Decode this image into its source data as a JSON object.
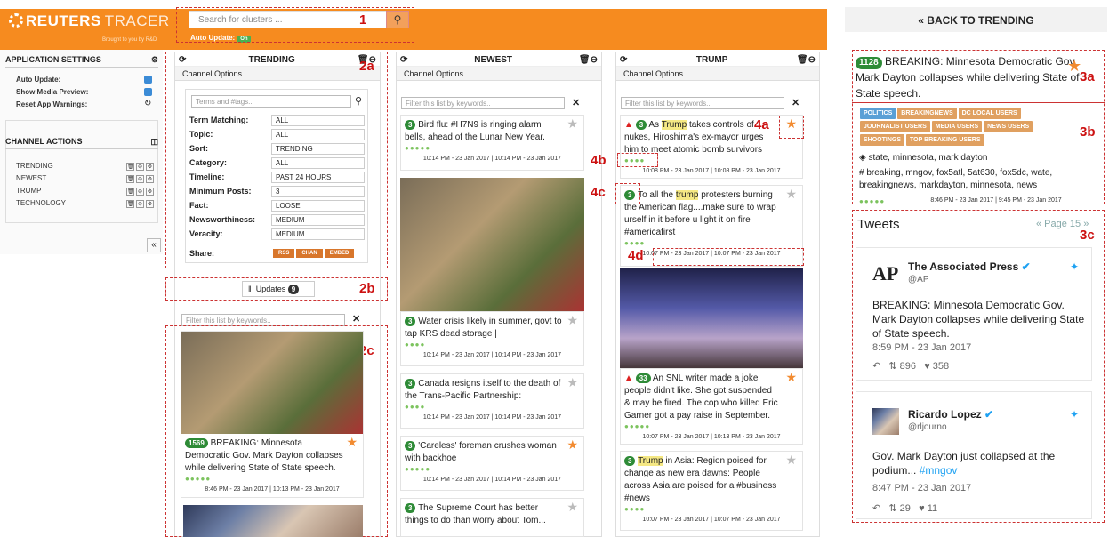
{
  "header": {
    "logo_text": "REUTERS",
    "logo_sub_text": "TRACER",
    "tagline": "Brought to you by R&D",
    "search_placeholder": "Search for clusters ...",
    "auto_update_label": "Auto Update:",
    "auto_update_state": "On"
  },
  "callouts": {
    "c1": "1",
    "c2a": "2a",
    "c2b": "2b",
    "c2c": "2c",
    "c3a": "3a",
    "c3b": "3b",
    "c3c": "3c",
    "c4a": "4a",
    "c4b": "4b",
    "c4c": "4c",
    "c4d": "4d"
  },
  "left": {
    "app_settings_title": "APPLICATION SETTINGS",
    "settings": [
      "Auto Update:",
      "Show Media Preview:",
      "Reset App Warnings:"
    ],
    "channel_actions_title": "CHANNEL ACTIONS",
    "channels": [
      "TRENDING",
      "NEWEST",
      "TRUMP",
      "TECHNOLOGY"
    ]
  },
  "trending": {
    "title": "TRENDING",
    "channel_options": "Channel Options",
    "terms_placeholder": "Terms and #tags..",
    "options": [
      {
        "label": "Term Matching:",
        "value": "ALL"
      },
      {
        "label": "Topic:",
        "value": "ALL"
      },
      {
        "label": "Sort:",
        "value": "TRENDING"
      },
      {
        "label": "Category:",
        "value": "ALL"
      },
      {
        "label": "Timeline:",
        "value": "PAST 24 HOURS"
      },
      {
        "label": "Minimum Posts:",
        "value": "3"
      },
      {
        "label": "Fact:",
        "value": "LOOSE"
      },
      {
        "label": "Newsworthiness:",
        "value": "MEDIUM"
      },
      {
        "label": "Veracity:",
        "value": "MEDIUM"
      }
    ],
    "share_label": "Share:",
    "share_buttons": [
      "RSS",
      "CHAN",
      "EMBED"
    ],
    "updates_label": "Updates",
    "updates_count": "9",
    "filter_placeholder": "Filter this list by keywords..",
    "card": {
      "count": "1569",
      "text": "BREAKING: Minnesota Democratic Gov. Mark Dayton collapses while delivering State of State speech.",
      "time": "8:46 PM - 23 Jan 2017 | 10:13 PM - 23 Jan 2017"
    }
  },
  "newest": {
    "title": "NEWEST",
    "channel_options": "Channel Options",
    "filter_placeholder": "Filter this list by keywords..",
    "cards": [
      {
        "count": "3",
        "text": "Bird flu: #H7N9 is ringing alarm bells, ahead of the Lunar New Year.",
        "time": "10:14 PM - 23 Jan 2017 | 10:14 PM - 23 Jan 2017"
      },
      {
        "count": "3",
        "text": "Water crisis likely in summer, govt to tap KRS dead storage |",
        "time": "10:14 PM - 23 Jan 2017 | 10:14 PM - 23 Jan 2017"
      },
      {
        "count": "3",
        "text": "Canada resigns itself to the death of the Trans-Pacific Partnership:",
        "time": "10:14 PM - 23 Jan 2017 | 10:14 PM - 23 Jan 2017"
      },
      {
        "count": "3",
        "text": "'Careless' foreman crushes woman with backhoe",
        "time": "10:14 PM - 23 Jan 2017 | 10:14 PM - 23 Jan 2017"
      },
      {
        "count": "3",
        "text": "The Supreme Court has better things to do than worry about Tom...",
        "time": ""
      }
    ]
  },
  "trump": {
    "title": "TRUMP",
    "channel_options": "Channel Options",
    "filter_placeholder": "Filter this list by keywords..",
    "cards": [
      {
        "count": "3",
        "pre": "As ",
        "hl": "Trump",
        "post": " takes controls of nukes, Hiroshima's ex-mayor urges him to meet atomic bomb survivors",
        "time": "10:08 PM - 23 Jan 2017 | 10:08 PM - 23 Jan 2017"
      },
      {
        "count": "3",
        "pre": "To all the ",
        "hl": "trump",
        "post": " protesters burning the American flag....make sure to wrap urself in it before u light it on fire #americafirst",
        "time": "10:07 PM - 23 Jan 2017 | 10:07 PM - 23 Jan 2017"
      },
      {
        "count": "33",
        "pre": "An SNL writer made a joke people didn't like. She got suspended & may be fired. The cop who killed Eric Garner got a pay raise in September.",
        "hl": "",
        "post": "",
        "time": "10:07 PM - 23 Jan 2017 | 10:13 PM - 23 Jan 2017"
      },
      {
        "count": "3",
        "pre": "",
        "hl": "Trump",
        "post": " in Asia: Region poised for change as new era dawns: People across Asia are poised for a #business #news",
        "time": "10:07 PM - 23 Jan 2017 | 10:07 PM - 23 Jan 2017"
      }
    ]
  },
  "detail": {
    "back_label": "« BACK TO TRENDING",
    "count": "1128",
    "text": "BREAKING: Minnesota Democratic Gov. Mark Dayton collapses while delivering State of State speech.",
    "tags": [
      {
        "label": "POLITICS",
        "color": "#5aa0d6"
      },
      {
        "label": "BREAKINGNEWS",
        "color": "#e0a060"
      },
      {
        "label": "DC LOCAL USERS",
        "color": "#e0a060"
      },
      {
        "label": "JOURNALIST USERS",
        "color": "#e0a060"
      },
      {
        "label": "MEDIA USERS",
        "color": "#e0a060"
      },
      {
        "label": "NEWS USERS",
        "color": "#e0a060"
      },
      {
        "label": "SHOOTINGS",
        "color": "#e0a060"
      },
      {
        "label": "TOP BREAKING USERS",
        "color": "#e0a060"
      }
    ],
    "entities": "state, minnesota, mark dayton",
    "hashtags": "breaking, mngov, fox5atl, 5at630, fox5dc, wate, breakingnews, markdayton, minnesota, news",
    "time": "8:46 PM - 23 Jan 2017 | 9:45 PM - 23 Jan 2017",
    "tweets_title": "Tweets",
    "page_label": "« Page 15 »",
    "tweets": [
      {
        "name": "The Associated Press",
        "handle": "@AP",
        "text": "BREAKING: Minnesota Democratic Gov. Mark Dayton collapses while delivering State of State speech.",
        "time": "8:59 PM - 23 Jan 2017",
        "retweets": "896",
        "likes": "358"
      },
      {
        "name": "Ricardo Lopez",
        "handle": "@rljourno",
        "text_pre": "Gov. Mark Dayton just collapsed at the podium... ",
        "text_link": "#mngov",
        "time": "8:47 PM - 23 Jan 2017",
        "retweets": "29",
        "likes": "11"
      }
    ]
  }
}
